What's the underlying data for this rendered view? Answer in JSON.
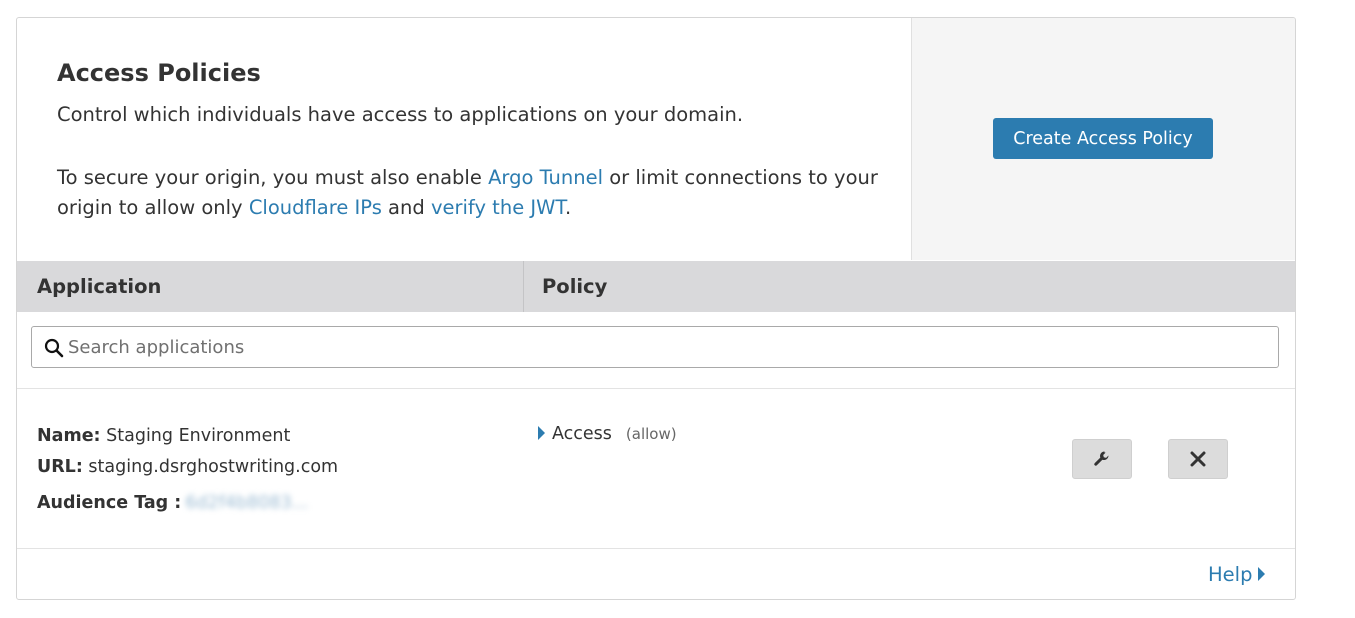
{
  "header": {
    "title": "Access Policies",
    "description": "Control which individuals have access to applications on your domain.",
    "secure_text_1": "To secure your origin, you must also enable ",
    "argo_link": "Argo Tunnel",
    "secure_text_2": " or limit connections to your origin to allow only ",
    "cloudflare_ips_link": "Cloudflare IPs",
    "secure_text_3": " and ",
    "jwt_link": "verify the JWT",
    "secure_text_4": ".",
    "create_button_label": "Create Access Policy"
  },
  "table": {
    "columns": [
      "Application",
      "Policy"
    ],
    "search_placeholder": "Search applications",
    "rows": [
      {
        "name_label": "Name:",
        "name": "Staging Environment",
        "url_label": "URL:",
        "url": "staging.dsrghostwriting.com",
        "audience_label": "Audience Tag :",
        "audience_tag": "6d2f4b8083...",
        "policy_name": "Access",
        "policy_decision": "(allow)"
      }
    ]
  },
  "footer": {
    "help_label": "Help"
  },
  "colors": {
    "accent": "#2c7cb0",
    "header_bg": "#d9d9db",
    "panel_bg": "#f5f5f5"
  },
  "icons": [
    "search-icon",
    "wrench-icon",
    "close-icon",
    "caret-right-icon"
  ]
}
